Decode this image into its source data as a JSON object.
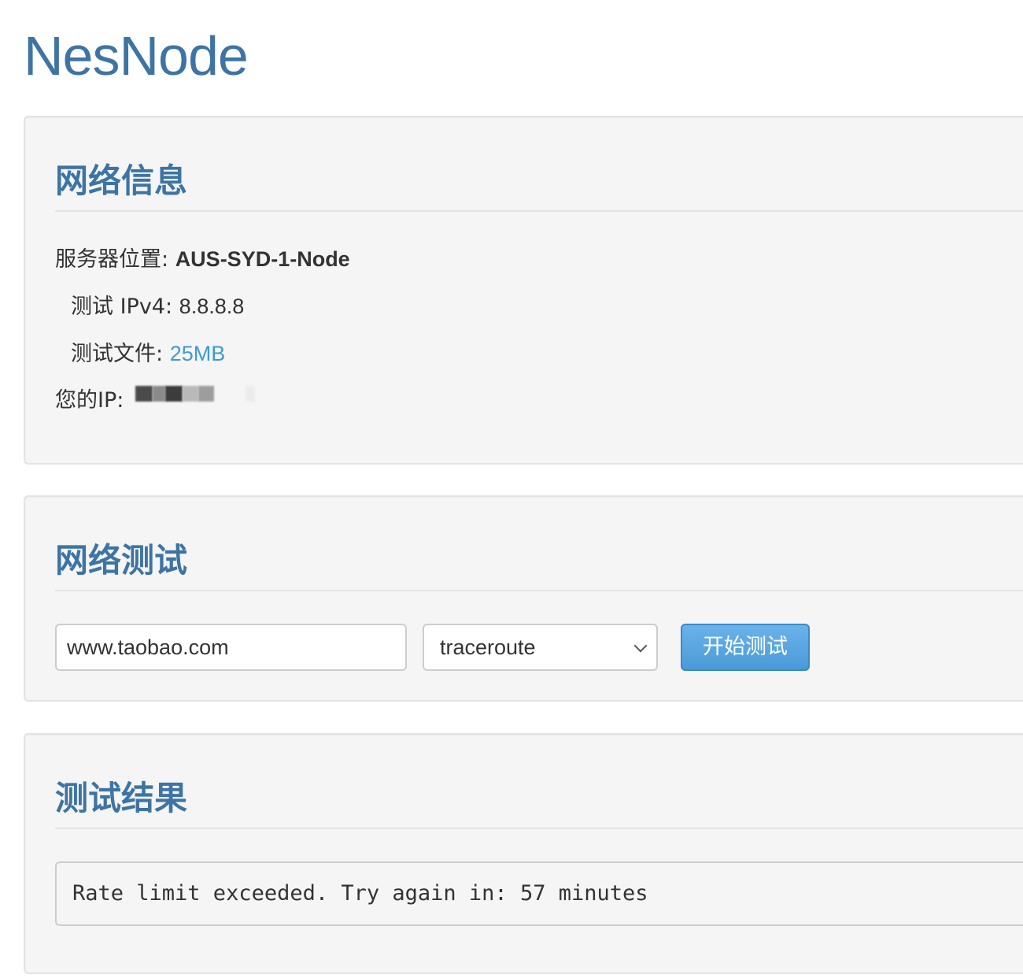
{
  "brand": {
    "name": "NesNode"
  },
  "network_info": {
    "title": "网络信息",
    "location_label": "服务器位置: ",
    "location_value": "AUS-SYD-1-Node",
    "ipv4_label": "测试 IPv4: ",
    "ipv4_value": "8.8.8.8",
    "file_label": "测试文件: ",
    "file_link": "25MB",
    "your_ip_label": "您的IP: "
  },
  "network_test": {
    "title": "网络测试",
    "host_value": "www.taobao.com",
    "method_selected": "traceroute",
    "start_button": "开始测试"
  },
  "test_result": {
    "title": "测试结果",
    "output": "Rate limit exceeded. Try again in: 57 minutes"
  },
  "colors": {
    "brand": "#3d74a4",
    "link": "#3d9ad8",
    "button": "#4a9ad8",
    "panel_bg": "#f5f5f5"
  }
}
